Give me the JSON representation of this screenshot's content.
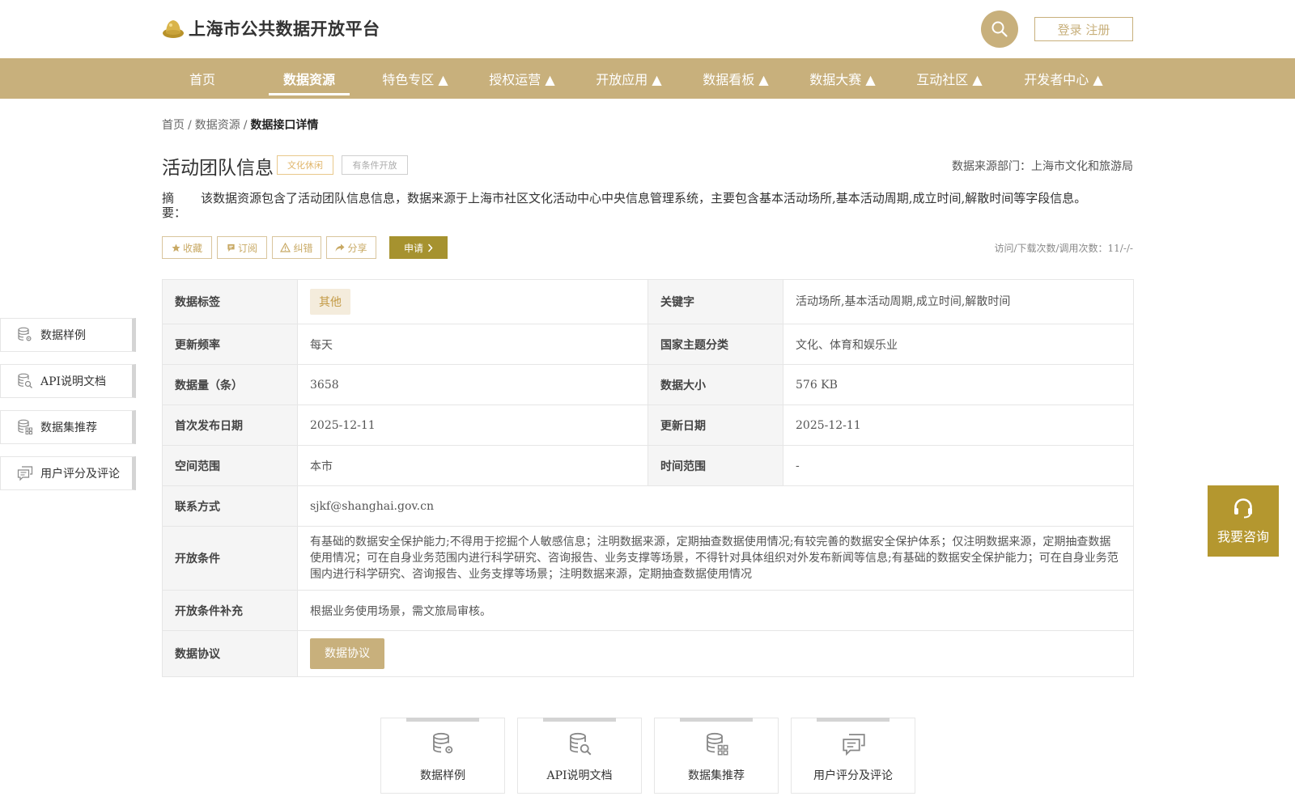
{
  "header": {
    "site_title": "上海市公共数据开放平台",
    "login_label": "登录 注册",
    "icons": {
      "logo": "gold-ingot-logo",
      "search": "search-icon"
    }
  },
  "nav": {
    "items": [
      {
        "label": "首页"
      },
      {
        "label": "数据资源",
        "active": true
      },
      {
        "label": "特色专区 ▲"
      },
      {
        "label": "授权运营 ▲"
      },
      {
        "label": "开放应用 ▲"
      },
      {
        "label": "数据看板 ▲"
      },
      {
        "label": "数据大赛 ▲"
      },
      {
        "label": "互动社区 ▲"
      },
      {
        "label": "开发者中心 ▲"
      }
    ]
  },
  "breadcrumb": {
    "home": "首页",
    "sep1": "/",
    "resources": "数据资源",
    "sep2": "/",
    "current": "数据接口详情"
  },
  "detail": {
    "title": "活动团队信息",
    "tags": [
      "文化休闲",
      "有条件开放"
    ],
    "source_dept": "数据来源部门：上海市文化和旅游局",
    "summary_label": "摘要：",
    "summary_text": "该数据资源包含了活动团队信息信息，数据来源于上海市社区文化活动中心中央信息管理系统，主要包含基本活动场所,基本活动周期,成立时间,解散时间等字段信息。",
    "actions": {
      "favorite": "收藏",
      "subscribe": "订阅",
      "correct": "纠错",
      "share": "分享",
      "apply": "申请"
    },
    "visits": "访问/下载次数/调用次数：11/-/-"
  },
  "info": {
    "data_tag_label": "数据标签",
    "data_tag_value": "其他",
    "keywords_label": "关键字",
    "keywords_value": "活动场所,基本活动周期,成立时间,解散时间",
    "update_freq_label": "更新频率",
    "update_freq_value": "每天",
    "national_theme_label": "国家主题分类",
    "national_theme_value": "文化、体育和娱乐业",
    "data_count_label": "数据量（条）",
    "data_count_value": "3658",
    "data_size_label": "数据大小",
    "data_size_value": "576 KB",
    "first_publish_label": "首次发布日期",
    "first_publish_value": "2025-12-11",
    "update_date_label": "更新日期",
    "update_date_value": "2025-12-11",
    "spatial_label": "空间范围",
    "spatial_value": "本市",
    "time_range_label": "时间范围",
    "time_range_value": "-",
    "contact_label": "联系方式",
    "contact_value": "sjkf@shanghai.gov.cn",
    "open_cond_label": "开放条件",
    "open_cond_value": "有基础的数据安全保护能力;不得用于挖掘个人敏感信息；注明数据来源，定期抽查数据使用情况;有较完善的数据安全保护体系；仅注明数据来源，定期抽查数据使用情况；可在自身业务范围内进行科学研究、咨询报告、业务支撑等场景，不得针对具体组织对外发布新闻等信息;有基础的数据安全保护能力；可在自身业务范围内进行科学研究、咨询报告、业务支撑等场景；注明数据来源，定期抽查数据使用情况",
    "open_cond_extra_label": "开放条件补充",
    "open_cond_extra_value": "根据业务使用场景，需文旅局审核。",
    "protocol_label": "数据协议",
    "protocol_button": "数据协议"
  },
  "side_nav": {
    "items": [
      {
        "label": "数据样例",
        "icon": "database-gear-icon"
      },
      {
        "label": "API说明文档",
        "icon": "database-search-icon"
      },
      {
        "label": "数据集推荐",
        "icon": "database-grid-icon"
      },
      {
        "label": "用户评分及评论",
        "icon": "comment-icon"
      }
    ]
  },
  "consult": {
    "label": "我要咨询",
    "icon": "headset-icon"
  },
  "bottom_cards": {
    "items": [
      {
        "label": "数据样例",
        "icon": "database-gear-icon"
      },
      {
        "label": "API说明文档",
        "icon": "database-search-icon"
      },
      {
        "label": "数据集推荐",
        "icon": "database-grid-icon"
      },
      {
        "label": "用户评分及评论",
        "icon": "comment-icon"
      }
    ]
  },
  "colors": {
    "brand_gold": "#c8b07c",
    "apply_olive": "#a6922f",
    "consult_gold": "#b4972f",
    "tag_orange": "#e0b56a"
  }
}
